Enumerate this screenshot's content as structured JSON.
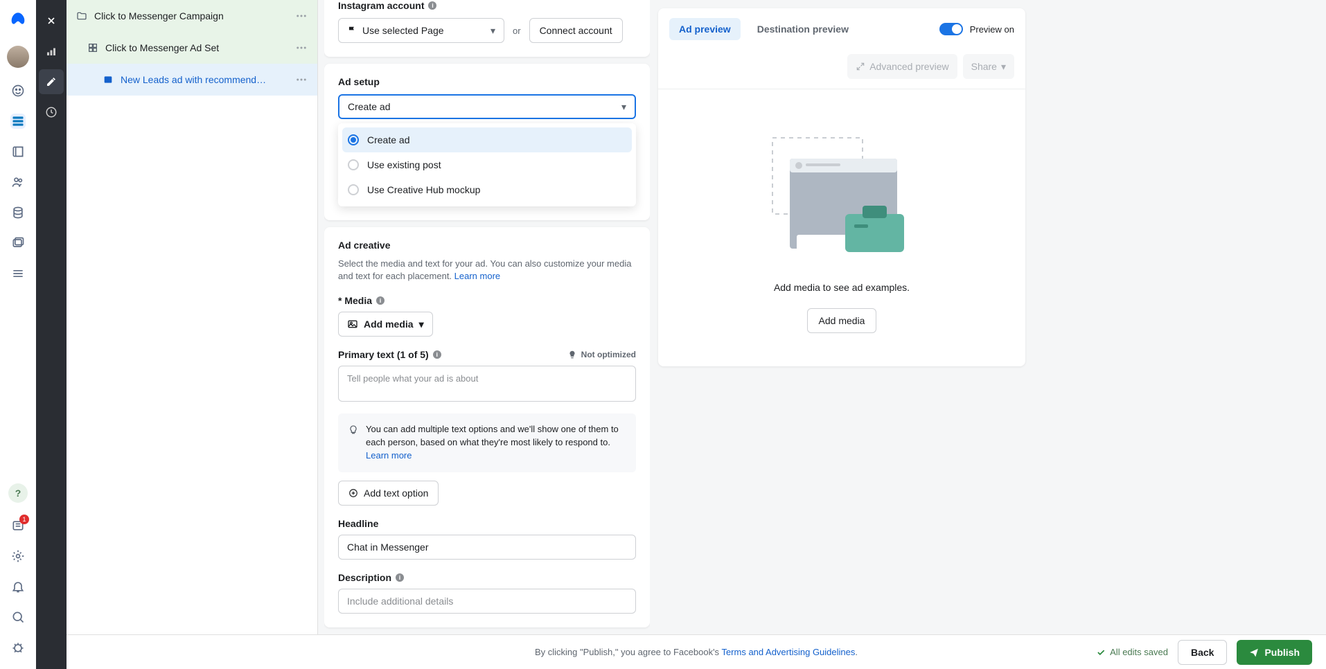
{
  "rail": {
    "badge_count": "1"
  },
  "tree": {
    "campaign": "Click to Messenger Campaign",
    "adset": "Click to Messenger Ad Set",
    "ad": "New Leads ad with recommend…"
  },
  "instagram": {
    "label": "Instagram account",
    "use_selected": "Use selected Page",
    "or": "or",
    "connect": "Connect account"
  },
  "adsetup": {
    "title": "Ad setup",
    "selected": "Create ad",
    "options": [
      "Create ad",
      "Use existing post",
      "Use Creative Hub mockup"
    ]
  },
  "creative": {
    "title": "Ad creative",
    "desc": "Select the media and text for your ad. You can also customize your media and text for each placement. ",
    "learn_more": "Learn more",
    "media_label": "* Media",
    "add_media": "Add media",
    "primary_label": "Primary text (1 of 5)",
    "not_optimized": "Not optimized",
    "primary_placeholder": "Tell people what your ad is about",
    "tip": "You can add multiple text options and we'll show one of them to each person, based on what they're most likely to respond to.",
    "tip_learn": "Learn more",
    "add_text_option": "Add text option",
    "headline_label": "Headline",
    "headline_value": "Chat in Messenger",
    "description_label": "Description",
    "description_placeholder": "Include additional details"
  },
  "preview": {
    "tab_preview": "Ad preview",
    "tab_destination": "Destination preview",
    "preview_on": "Preview on",
    "advanced": "Advanced preview",
    "share": "Share",
    "empty_msg": "Add media to see ad examples.",
    "add_media": "Add media"
  },
  "footer": {
    "agree_pre": "By clicking \"Publish,\" you agree to Facebook's ",
    "terms": "Terms and Advertising Guidelines",
    "saved": "All edits saved",
    "back": "Back",
    "publish": "Publish"
  }
}
